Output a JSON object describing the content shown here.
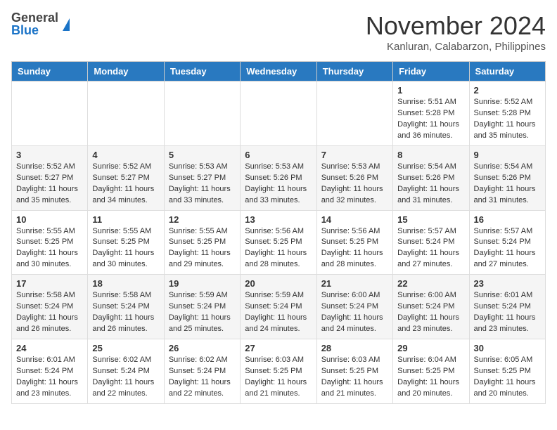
{
  "header": {
    "logo_general": "General",
    "logo_blue": "Blue",
    "month_title": "November 2024",
    "location": "Kanluran, Calabarzon, Philippines"
  },
  "weekdays": [
    "Sunday",
    "Monday",
    "Tuesday",
    "Wednesday",
    "Thursday",
    "Friday",
    "Saturday"
  ],
  "weeks": [
    [
      {
        "day": "",
        "info": ""
      },
      {
        "day": "",
        "info": ""
      },
      {
        "day": "",
        "info": ""
      },
      {
        "day": "",
        "info": ""
      },
      {
        "day": "",
        "info": ""
      },
      {
        "day": "1",
        "info": "Sunrise: 5:51 AM\nSunset: 5:28 PM\nDaylight: 11 hours\nand 36 minutes."
      },
      {
        "day": "2",
        "info": "Sunrise: 5:52 AM\nSunset: 5:28 PM\nDaylight: 11 hours\nand 35 minutes."
      }
    ],
    [
      {
        "day": "3",
        "info": "Sunrise: 5:52 AM\nSunset: 5:27 PM\nDaylight: 11 hours\nand 35 minutes."
      },
      {
        "day": "4",
        "info": "Sunrise: 5:52 AM\nSunset: 5:27 PM\nDaylight: 11 hours\nand 34 minutes."
      },
      {
        "day": "5",
        "info": "Sunrise: 5:53 AM\nSunset: 5:27 PM\nDaylight: 11 hours\nand 33 minutes."
      },
      {
        "day": "6",
        "info": "Sunrise: 5:53 AM\nSunset: 5:26 PM\nDaylight: 11 hours\nand 33 minutes."
      },
      {
        "day": "7",
        "info": "Sunrise: 5:53 AM\nSunset: 5:26 PM\nDaylight: 11 hours\nand 32 minutes."
      },
      {
        "day": "8",
        "info": "Sunrise: 5:54 AM\nSunset: 5:26 PM\nDaylight: 11 hours\nand 31 minutes."
      },
      {
        "day": "9",
        "info": "Sunrise: 5:54 AM\nSunset: 5:26 PM\nDaylight: 11 hours\nand 31 minutes."
      }
    ],
    [
      {
        "day": "10",
        "info": "Sunrise: 5:55 AM\nSunset: 5:25 PM\nDaylight: 11 hours\nand 30 minutes."
      },
      {
        "day": "11",
        "info": "Sunrise: 5:55 AM\nSunset: 5:25 PM\nDaylight: 11 hours\nand 30 minutes."
      },
      {
        "day": "12",
        "info": "Sunrise: 5:55 AM\nSunset: 5:25 PM\nDaylight: 11 hours\nand 29 minutes."
      },
      {
        "day": "13",
        "info": "Sunrise: 5:56 AM\nSunset: 5:25 PM\nDaylight: 11 hours\nand 28 minutes."
      },
      {
        "day": "14",
        "info": "Sunrise: 5:56 AM\nSunset: 5:25 PM\nDaylight: 11 hours\nand 28 minutes."
      },
      {
        "day": "15",
        "info": "Sunrise: 5:57 AM\nSunset: 5:24 PM\nDaylight: 11 hours\nand 27 minutes."
      },
      {
        "day": "16",
        "info": "Sunrise: 5:57 AM\nSunset: 5:24 PM\nDaylight: 11 hours\nand 27 minutes."
      }
    ],
    [
      {
        "day": "17",
        "info": "Sunrise: 5:58 AM\nSunset: 5:24 PM\nDaylight: 11 hours\nand 26 minutes."
      },
      {
        "day": "18",
        "info": "Sunrise: 5:58 AM\nSunset: 5:24 PM\nDaylight: 11 hours\nand 26 minutes."
      },
      {
        "day": "19",
        "info": "Sunrise: 5:59 AM\nSunset: 5:24 PM\nDaylight: 11 hours\nand 25 minutes."
      },
      {
        "day": "20",
        "info": "Sunrise: 5:59 AM\nSunset: 5:24 PM\nDaylight: 11 hours\nand 24 minutes."
      },
      {
        "day": "21",
        "info": "Sunrise: 6:00 AM\nSunset: 5:24 PM\nDaylight: 11 hours\nand 24 minutes."
      },
      {
        "day": "22",
        "info": "Sunrise: 6:00 AM\nSunset: 5:24 PM\nDaylight: 11 hours\nand 23 minutes."
      },
      {
        "day": "23",
        "info": "Sunrise: 6:01 AM\nSunset: 5:24 PM\nDaylight: 11 hours\nand 23 minutes."
      }
    ],
    [
      {
        "day": "24",
        "info": "Sunrise: 6:01 AM\nSunset: 5:24 PM\nDaylight: 11 hours\nand 23 minutes."
      },
      {
        "day": "25",
        "info": "Sunrise: 6:02 AM\nSunset: 5:24 PM\nDaylight: 11 hours\nand 22 minutes."
      },
      {
        "day": "26",
        "info": "Sunrise: 6:02 AM\nSunset: 5:24 PM\nDaylight: 11 hours\nand 22 minutes."
      },
      {
        "day": "27",
        "info": "Sunrise: 6:03 AM\nSunset: 5:25 PM\nDaylight: 11 hours\nand 21 minutes."
      },
      {
        "day": "28",
        "info": "Sunrise: 6:03 AM\nSunset: 5:25 PM\nDaylight: 11 hours\nand 21 minutes."
      },
      {
        "day": "29",
        "info": "Sunrise: 6:04 AM\nSunset: 5:25 PM\nDaylight: 11 hours\nand 20 minutes."
      },
      {
        "day": "30",
        "info": "Sunrise: 6:05 AM\nSunset: 5:25 PM\nDaylight: 11 hours\nand 20 minutes."
      }
    ]
  ]
}
